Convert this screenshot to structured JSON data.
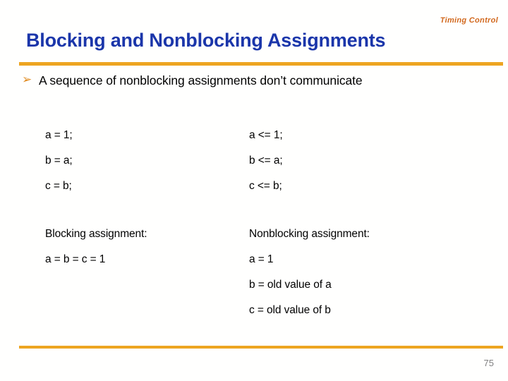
{
  "slide": {
    "running_header": "Timing Control",
    "title": "Blocking and Nonblocking Assignments",
    "page_number": "75",
    "accent_orange": "#eda521",
    "title_blue": "#1b36aa",
    "header_orange": "#d2691e",
    "bullet_glyph": "➢",
    "bullet_text": "A sequence of nonblocking assignments don’t communicate",
    "left_column": {
      "code_lines": [
        "a = 1;",
        "b = a;",
        "c = b;"
      ],
      "note_heading": "Blocking assignment:",
      "note_lines": [
        "a = b = c = 1"
      ]
    },
    "right_column": {
      "code_lines": [
        "a <= 1;",
        "b <= a;",
        "c <= b;"
      ],
      "note_heading": "Nonblocking assignment:",
      "note_lines": [
        "a = 1",
        "b = old value of a",
        "c = old value of b"
      ]
    }
  }
}
